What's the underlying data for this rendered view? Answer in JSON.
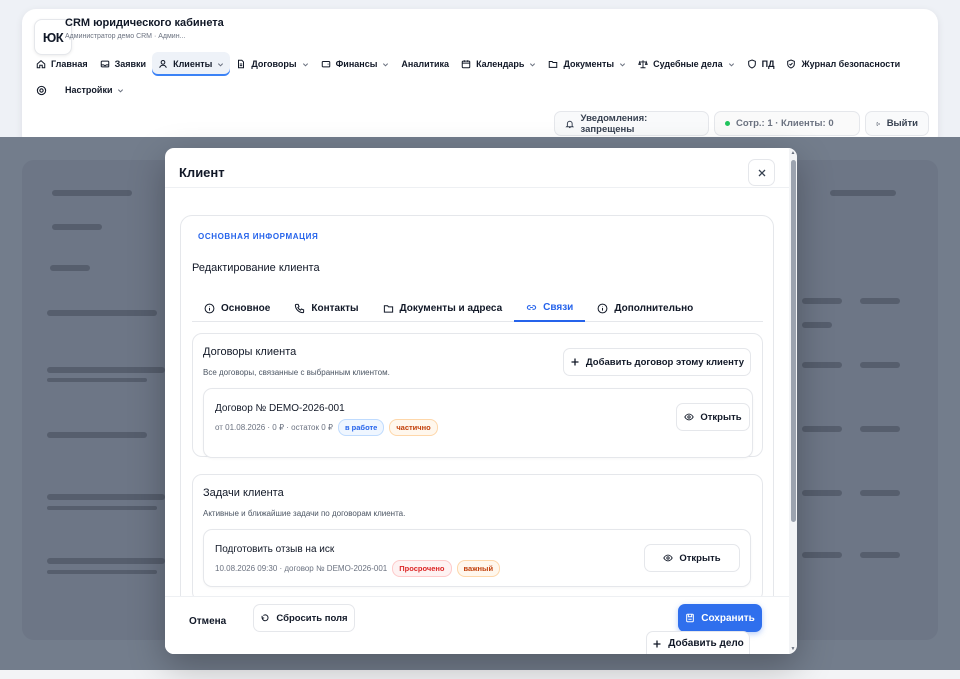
{
  "app": {
    "logo_text": "ЮК",
    "title": "CRM юридического кабинета",
    "subtitle": "Администратор демо CRM · Админ..."
  },
  "nav": {
    "items": [
      {
        "label": "Главная",
        "icon": "home-icon"
      },
      {
        "label": "Заявки",
        "icon": "inbox-icon"
      },
      {
        "label": "Клиенты",
        "icon": "user-icon",
        "active": true,
        "dropdown": true
      },
      {
        "label": "Договоры",
        "icon": "file-icon",
        "dropdown": true
      },
      {
        "label": "Финансы",
        "icon": "wallet-icon",
        "dropdown": true
      },
      {
        "label": "Аналитика"
      },
      {
        "label": "Календарь",
        "icon": "calendar-icon",
        "dropdown": true
      },
      {
        "label": "Документы",
        "icon": "folder-icon",
        "dropdown": true
      },
      {
        "label": "Судебные дела",
        "icon": "scale-icon",
        "dropdown": true
      },
      {
        "label": "ПД",
        "icon": "shield-icon"
      },
      {
        "label": "Журнал безопасности",
        "icon": "shield-check-icon"
      }
    ],
    "settings_label": "Настройки"
  },
  "header": {
    "notifications_label": "Уведомления: запрещены",
    "status_label": "Сотр.: 1 · Клиенты: 0",
    "logout_label": "Выйти"
  },
  "modal": {
    "title": "Клиент",
    "section_tag": "Основная информация",
    "heading": "Редактирование клиента",
    "tabs": [
      {
        "label": "Основное",
        "icon": "info-icon"
      },
      {
        "label": "Контакты",
        "icon": "phone-icon"
      },
      {
        "label": "Документы и адреса",
        "icon": "folder-icon"
      },
      {
        "label": "Связи",
        "icon": "link-icon",
        "active": true
      },
      {
        "label": "Дополнительно",
        "icon": "info-icon"
      }
    ],
    "contracts": {
      "title": "Договоры клиента",
      "description": "Все договоры, связанные с выбранным клиентом.",
      "add_label": "Добавить договор этому клиенту",
      "items": [
        {
          "title": "Договор № DEMO-2026-001",
          "meta": "от 01.08.2026 · 0 ₽ · остаток 0 ₽",
          "badges": [
            "в работе",
            "частично"
          ],
          "open_label": "Открыть"
        }
      ]
    },
    "tasks": {
      "title": "Задачи клиента",
      "description": "Активные и ближайшие задачи по договорам клиента.",
      "items": [
        {
          "title": "Подготовить отзыв на иск",
          "meta": "10.08.2026 09:30 · договор № DEMO-2026-001",
          "badges": [
            "Просрочено",
            "важный"
          ],
          "open_label": "Открыть"
        }
      ]
    },
    "add_case_label": "Добавить дело",
    "footer": {
      "cancel_label": "Отмена",
      "reset_label": "Сбросить поля",
      "save_label": "Сохранить"
    }
  },
  "colors": {
    "accent": "#2f6fed",
    "backdrop": "#737d8c",
    "danger": "#dc2626",
    "warning": "#c2410c"
  }
}
